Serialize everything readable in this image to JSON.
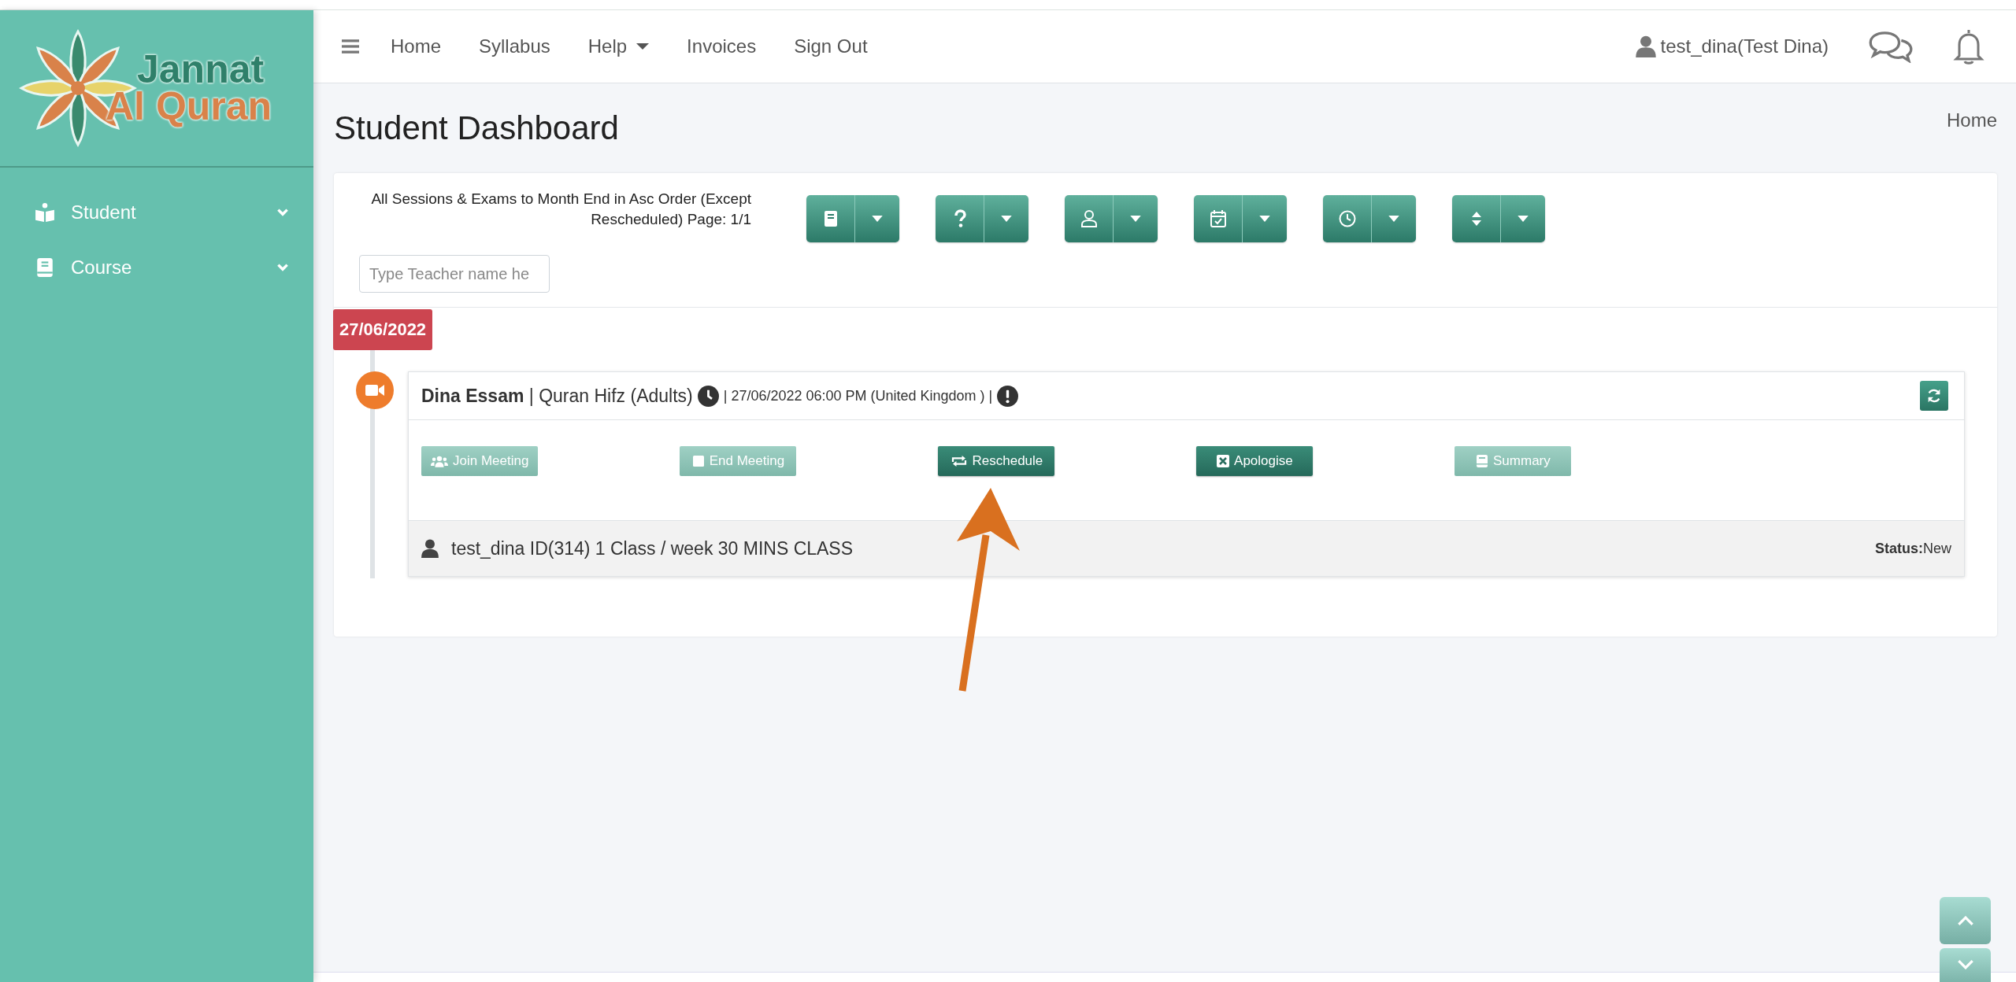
{
  "logo": {
    "line1": "Jannat",
    "line2": "Al Quran"
  },
  "sidebar": {
    "items": [
      {
        "label": "Student",
        "kind": "student",
        "expanded": false
      },
      {
        "label": "Course",
        "kind": "course",
        "expanded": false
      }
    ]
  },
  "topbar": {
    "nav": [
      {
        "label": "Home",
        "has_menu": false
      },
      {
        "label": "Syllabus",
        "has_menu": false
      },
      {
        "label": "Help",
        "has_menu": true
      },
      {
        "label": "Invoices",
        "has_menu": false
      },
      {
        "label": "Sign Out",
        "has_menu": false
      }
    ],
    "user": "test_dina(Test Dina)"
  },
  "header": {
    "title": "Student Dashboard",
    "breadcrumb": "Home"
  },
  "filter": {
    "description_lines": [
      "All Sessions & Exams to Month End in Asc Order (Except",
      "Rescheduled) Page: 1/1"
    ],
    "toolbar": [
      {
        "kind": "book"
      },
      {
        "kind": "question"
      },
      {
        "kind": "user"
      },
      {
        "kind": "calendar"
      },
      {
        "kind": "clock"
      },
      {
        "kind": "sort"
      }
    ],
    "search": {
      "placeholder": "Type Teacher name he"
    }
  },
  "date": "27/06/2022",
  "session": {
    "title": "**Dina Essam** | Quran Hifz (Adults)",
    "time": "| 27/06/2022 06:00 PM (United Kingdom ) |",
    "actions": [
      {
        "label": "Join Meeting",
        "kind": "join",
        "disabled": true
      },
      {
        "label": "End Meeting",
        "kind": "end",
        "disabled": true
      },
      {
        "label": "Reschedule",
        "kind": "reschedule",
        "disabled": false
      },
      {
        "label": "Apologise",
        "kind": "apologise",
        "disabled": false
      },
      {
        "label": "Summary",
        "kind": "summary",
        "disabled": true
      }
    ],
    "info": "test_dina ID(314) 1 Class / week 30 MINS CLASS",
    "status": "**Status:**New"
  }
}
